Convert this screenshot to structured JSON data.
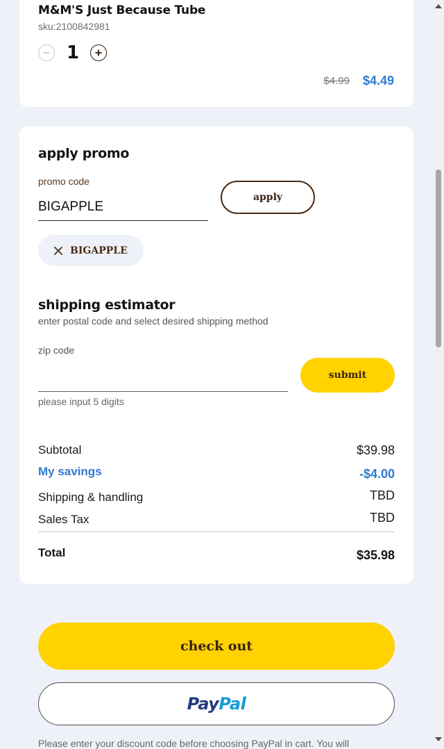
{
  "product": {
    "title": "M&M'S Just Because Tube",
    "sku_label": "sku:",
    "sku_value": "2100842981",
    "quantity": "1",
    "price_original": "$4.99",
    "price_sale": "$4.49"
  },
  "promo": {
    "title": "apply promo",
    "field_label": "promo code",
    "field_value": "BIGAPPLE",
    "apply_label": "apply",
    "applied_code": "BIGAPPLE"
  },
  "shipping": {
    "title": "shipping estimator",
    "subtitle": "enter postal code and select desired shipping method",
    "zip_label": "zip code",
    "zip_value": "",
    "submit_label": "submit",
    "hint": "please input 5 digits"
  },
  "summary": {
    "subtotal_label": "Subtotal",
    "subtotal_value": "$39.98",
    "savings_label": "My savings",
    "savings_value": "-$4.00",
    "shipping_label": "Shipping & handling",
    "shipping_value": "TBD",
    "tax_label": "Sales Tax",
    "tax_value": "TBD",
    "total_label": "Total",
    "total_value": "$35.98"
  },
  "actions": {
    "checkout_label": "check out",
    "paypal_pay": "Pay",
    "paypal_pal": "Pal"
  },
  "footer": {
    "note": "Please enter your discount code before choosing PayPal in cart. You will"
  },
  "colors": {
    "accent_blue": "#2f7bd1",
    "brand_yellow": "#ffd200",
    "brand_brown": "#3a2214",
    "page_background": "#eef2f8"
  }
}
